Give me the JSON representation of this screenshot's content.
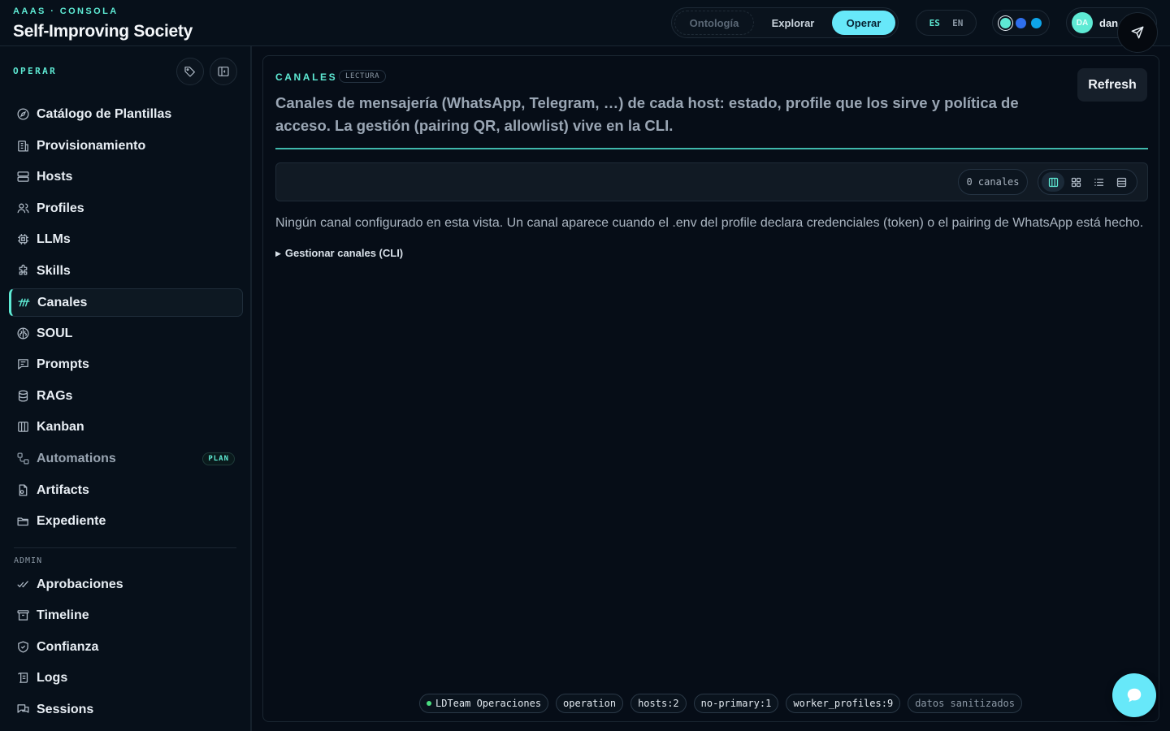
{
  "header": {
    "kicker": "AAAS · CONSOLA",
    "title": "Self-Improving Society",
    "modes": [
      "Ontología",
      "Explorar",
      "Operar"
    ],
    "active_mode": "Operar",
    "langs": [
      "ES",
      "EN"
    ],
    "active_lang": "ES",
    "theme_dots": [
      "#5eead4",
      "#2f6fed",
      "#0ea5e9"
    ],
    "user": {
      "initials": "DA",
      "name": "dan"
    }
  },
  "sidebar": {
    "section": "OPERAR",
    "items": [
      {
        "label": "Catálogo de Plantillas",
        "icon": "compass-icon"
      },
      {
        "label": "Provisionamiento",
        "icon": "building-icon"
      },
      {
        "label": "Hosts",
        "icon": "server-icon"
      },
      {
        "label": "Profiles",
        "icon": "users-icon"
      },
      {
        "label": "LLMs",
        "icon": "cpu-icon"
      },
      {
        "label": "Skills",
        "icon": "puzzle-icon"
      },
      {
        "label": "Canales",
        "icon": "channels-icon",
        "active": true
      },
      {
        "label": "SOUL",
        "icon": "brain-icon"
      },
      {
        "label": "Prompts",
        "icon": "message-square-icon"
      },
      {
        "label": "RAGs",
        "icon": "database-icon"
      },
      {
        "label": "Kanban",
        "icon": "kanban-icon"
      },
      {
        "label": "Automations",
        "icon": "workflow-icon",
        "badge": "PLAN",
        "dim": true
      },
      {
        "label": "Artifacts",
        "icon": "file-gear-icon"
      },
      {
        "label": "Expediente",
        "icon": "folder-open-icon"
      }
    ],
    "admin_section": "ADMIN",
    "admin_items": [
      {
        "label": "Aprobaciones",
        "icon": "check-check-icon"
      },
      {
        "label": "Timeline",
        "icon": "archive-icon"
      },
      {
        "label": "Confianza",
        "icon": "shield-check-icon"
      },
      {
        "label": "Logs",
        "icon": "scroll-icon"
      },
      {
        "label": "Sessions",
        "icon": "messages-icon"
      }
    ]
  },
  "main": {
    "kicker": "CANALES",
    "mode_badge": "LECTURA",
    "description": "Canales de mensajería (WhatsApp, Telegram, …) de cada host: estado, profile que los sirve y política de acceso. La gestión (pairing QR, allowlist) vive en la CLI.",
    "refresh_label": "Refresh",
    "count_label": "0 canales",
    "view_modes": [
      "columns-icon",
      "grid-icon",
      "list-icon",
      "table-icon"
    ],
    "empty_message": "Ningún canal configurado en esta vista. Un canal aparece cuando el .env del profile declara credenciales (token) o el pairing de WhatsApp está hecho.",
    "cli_toggle": "Gestionar canales (CLI)"
  },
  "footer": {
    "chips": [
      {
        "label": "LDTeam Operaciones",
        "dot": true
      },
      {
        "label": "operation"
      },
      {
        "label": "hosts:2"
      },
      {
        "label": "no-primary:1"
      },
      {
        "label": "worker_profiles:9"
      },
      {
        "label": "datos sanitizados",
        "muted": true
      }
    ]
  },
  "colors": {
    "accent": "#5eead4",
    "primary": "#67e8f9",
    "background": "#060d17"
  }
}
